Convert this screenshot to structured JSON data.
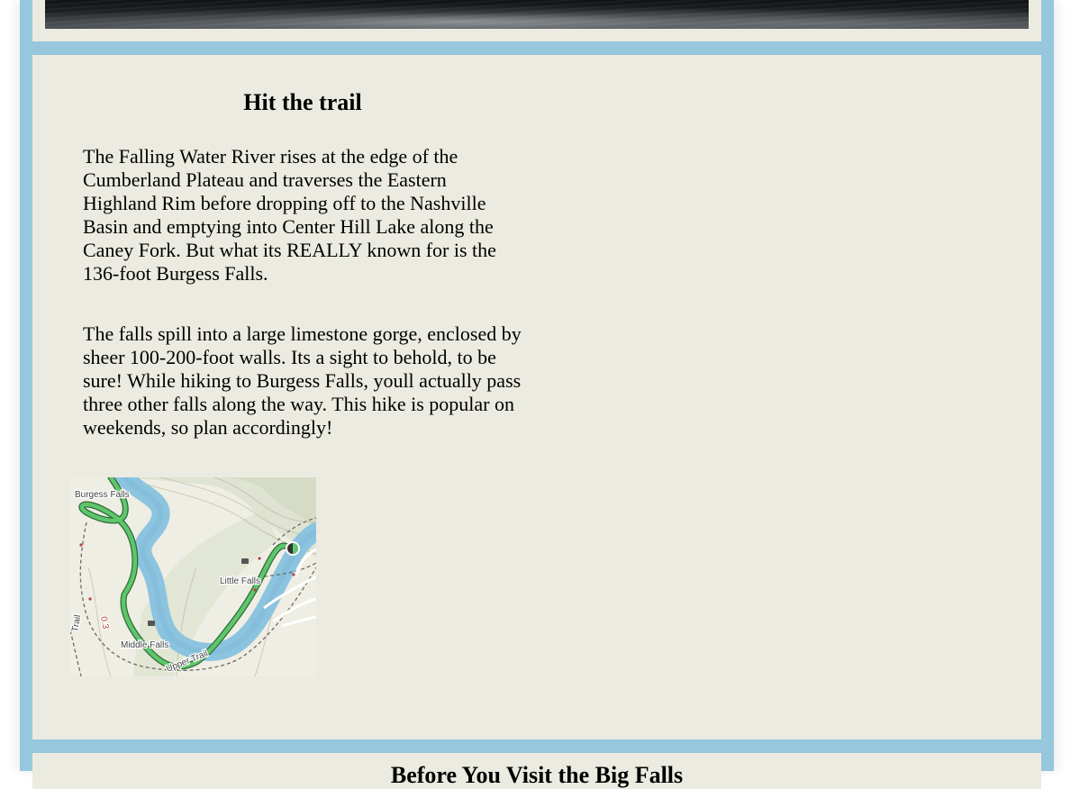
{
  "page": {
    "frame_color": "#96c7dc",
    "card_color": "#ecebe1"
  },
  "hero_image": {
    "description_icon": "water-photo"
  },
  "trail_section": {
    "title": "Hit the trail",
    "paragraphs": [
      "The Falling Water River rises at the edge of the Cumberland Plateau and traverses the Eastern Highland Rim before dropping off to the Nashville Basin and emptying into Center Hill Lake along the Caney Fork. But what its REALLY known for is the 136-foot Burgess Falls.",
      "The falls spill into a large limestone gorge, enclosed by sheer 100-200-foot walls. Its a sight to behold, to be sure! While hiking to Burgess Falls, youll actually pass three other falls along the way. This hike is popular on weekends, so plan accordingly!"
    ],
    "map": {
      "labels": {
        "burgess_falls": "Burgess Falls",
        "little_falls": "Little Falls",
        "middle_falls": "Middle Falls",
        "upper_trail": "Upper Trail",
        "trail": "Trail",
        "mile_marker": "0.3"
      },
      "colors": {
        "river": "#8cc4e0",
        "route": "#5fc66b",
        "land": "#efeee4"
      }
    }
  },
  "next_section": {
    "title": "Before You Visit the Big Falls"
  }
}
